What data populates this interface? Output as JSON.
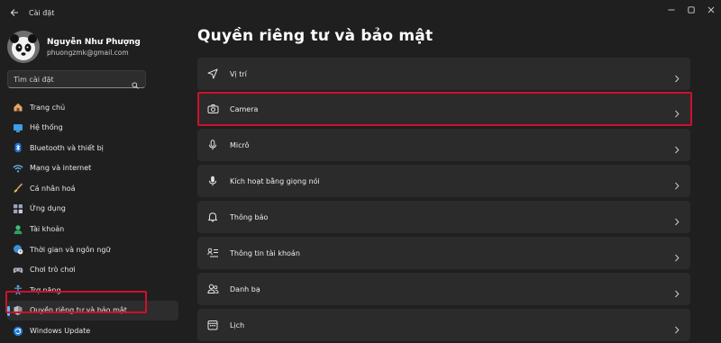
{
  "window": {
    "title": "Cài đặt"
  },
  "profile": {
    "name": "Nguyễn Như Phượng",
    "email": "phuongzmk@gmail.com"
  },
  "search": {
    "placeholder": "Tìm cài đặt"
  },
  "sidebar": {
    "items": [
      {
        "label": "Trang chủ",
        "icon": "home-icon"
      },
      {
        "label": "Hệ thống",
        "icon": "system-icon"
      },
      {
        "label": "Bluetooth và thiết bị",
        "icon": "bluetooth-icon"
      },
      {
        "label": "Mạng và internet",
        "icon": "wifi-icon"
      },
      {
        "label": "Cá nhân hoá",
        "icon": "brush-icon"
      },
      {
        "label": "Ứng dụng",
        "icon": "apps-icon"
      },
      {
        "label": "Tài khoản",
        "icon": "account-icon"
      },
      {
        "label": "Thời gian và ngôn ngữ",
        "icon": "globe-clock-icon"
      },
      {
        "label": "Chơi trò chơi",
        "icon": "gamepad-icon"
      },
      {
        "label": "Trợ năng",
        "icon": "accessibility-icon"
      },
      {
        "label": "Quyền riêng tư và bảo mật",
        "icon": "shield-icon",
        "selected": true
      },
      {
        "label": "Windows Update",
        "icon": "update-icon"
      }
    ]
  },
  "main": {
    "title": "Quyền riêng tư và bảo mật",
    "items": [
      {
        "label": "Vị trí",
        "icon": "location-icon"
      },
      {
        "label": "Camera",
        "icon": "camera-icon",
        "highlighted": true
      },
      {
        "label": "Micrô",
        "icon": "microphone-icon"
      },
      {
        "label": "Kích hoạt bằng giọng nói",
        "icon": "voice-activation-icon"
      },
      {
        "label": "Thông báo",
        "icon": "bell-icon"
      },
      {
        "label": "Thông tin tài khoản",
        "icon": "account-info-icon"
      },
      {
        "label": "Danh bạ",
        "icon": "contacts-icon"
      },
      {
        "label": "Lịch",
        "icon": "calendar-icon"
      }
    ]
  },
  "colors": {
    "accent": "#4cc2ff",
    "highlight": "#d0102a",
    "card": "#2b2b2b",
    "background": "#1f1f1f"
  }
}
